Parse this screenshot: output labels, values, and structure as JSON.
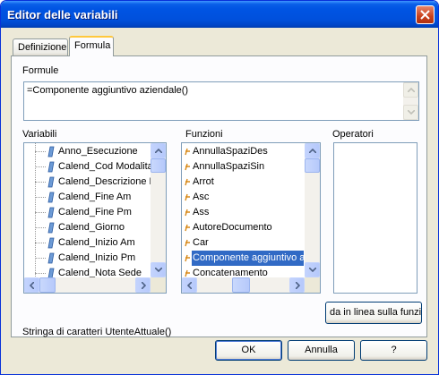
{
  "window": {
    "title": "Editor delle variabili"
  },
  "tabs": [
    {
      "label": "Definizione",
      "active": false
    },
    {
      "label": "Formula",
      "active": true
    }
  ],
  "formula": {
    "label": "Formule",
    "value": "=Componente aggiuntivo aziendale()"
  },
  "variables": {
    "label": "Variabili",
    "items": [
      "Anno_Esecuzione",
      "Calend_Cod Modalita",
      "Calend_Descrizione M",
      "Calend_Fine Am",
      "Calend_Fine Pm",
      "Calend_Giorno",
      "Calend_Inizio Am",
      "Calend_Inizio Pm",
      "Calend_Nota Sede"
    ],
    "icon": "variable-icon"
  },
  "functions": {
    "label": "Funzioni",
    "items": [
      "AnnullaSpaziDes",
      "AnnullaSpaziSin",
      "Arrot",
      "Asc",
      "Ass",
      "AutoreDocumento",
      "Car",
      "Componente aggiuntivo a",
      "Concatenamento"
    ],
    "selected_index": 7,
    "icon": "function-icon"
  },
  "operators": {
    "label": "Operatori",
    "items": []
  },
  "syntax_text": "Stringa di caratteri UtenteAttuale()",
  "inline_help_label": "da in linea sulla funzio",
  "buttons": {
    "ok": "OK",
    "cancel": "Annulla",
    "help": "?"
  },
  "colors": {
    "titlebar": "#0054e3",
    "selection": "#316ac5",
    "face": "#ece9d8"
  }
}
